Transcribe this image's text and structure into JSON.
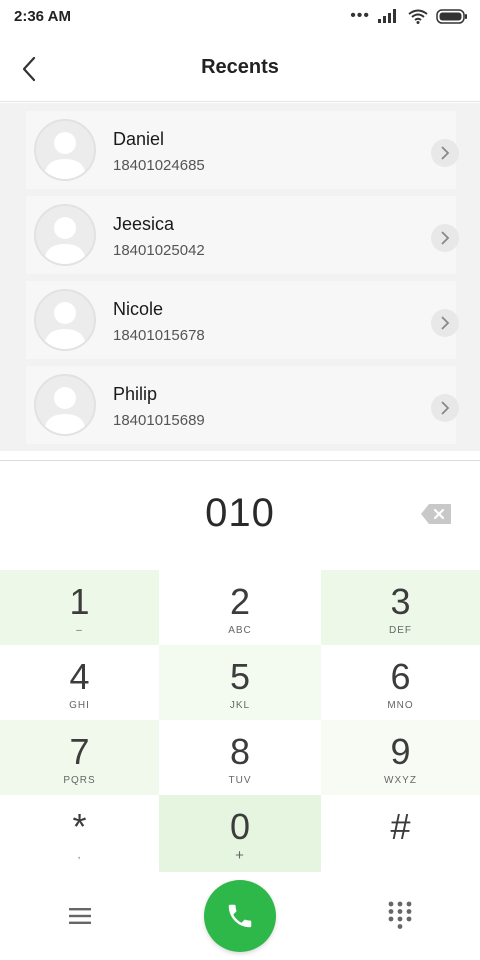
{
  "status_bar": {
    "time": "2:36 AM"
  },
  "header": {
    "title": "Recents"
  },
  "contacts": [
    {
      "name": "Daniel",
      "number": "18401024685"
    },
    {
      "name": "Jeesica",
      "number": "18401025042"
    },
    {
      "name": "Nicole",
      "number": "18401015678"
    },
    {
      "name": "Philip",
      "number": "18401015689"
    }
  ],
  "dialer": {
    "number": "010"
  },
  "keys": [
    {
      "digit": "1",
      "letters": "–"
    },
    {
      "digit": "2",
      "letters": "ABC"
    },
    {
      "digit": "3",
      "letters": "DEF"
    },
    {
      "digit": "4",
      "letters": "GHI"
    },
    {
      "digit": "5",
      "letters": "JKL"
    },
    {
      "digit": "6",
      "letters": "MNO"
    },
    {
      "digit": "7",
      "letters": "PQRS"
    },
    {
      "digit": "8",
      "letters": "TUV"
    },
    {
      "digit": "9",
      "letters": "WXYZ"
    },
    {
      "digit": "*",
      "letters": ","
    },
    {
      "digit": "0",
      "letters": "+"
    },
    {
      "digit": "#",
      "letters": ""
    }
  ],
  "colors": {
    "call_green": "#2fb84a",
    "key_highlight": "#eaf6e4"
  }
}
